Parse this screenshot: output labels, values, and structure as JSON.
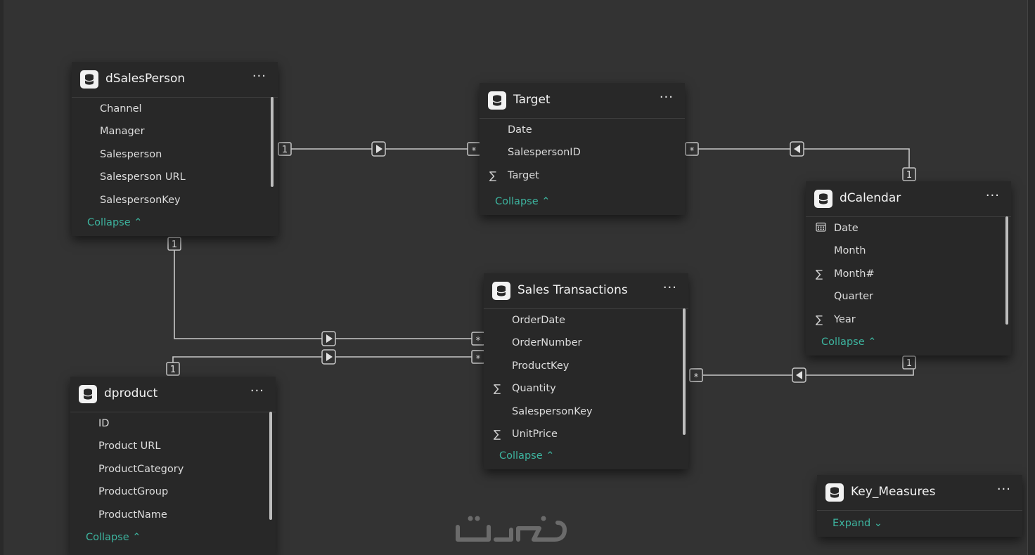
{
  "tables": {
    "dsalesperson": {
      "name": "dSalesPerson",
      "fields": [
        "Channel",
        "Manager",
        "Salesperson",
        "Salesperson URL",
        "SalespersonKey"
      ],
      "toggle": "Collapse"
    },
    "target": {
      "name": "Target",
      "fields": [
        "Date",
        "SalespersonID",
        "Target"
      ],
      "toggle": "Collapse"
    },
    "dcalendar": {
      "name": "dCalendar",
      "fields": [
        "Date",
        "Month",
        "Month#",
        "Quarter",
        "Year"
      ],
      "toggle": "Collapse"
    },
    "sales_transactions": {
      "name": "Sales Transactions",
      "fields": [
        "OrderDate",
        "OrderNumber",
        "ProductKey",
        "Quantity",
        "SalespersonKey",
        "UnitPrice"
      ],
      "toggle": "Collapse"
    },
    "dproduct": {
      "name": "dproduct",
      "fields": [
        "ID",
        "Product URL",
        "ProductCategory",
        "ProductGroup",
        "ProductName"
      ],
      "toggle": "Collapse"
    },
    "key_measures": {
      "name": "Key_Measures",
      "toggle": "Expand"
    }
  },
  "more_label": "···",
  "cardinality": {
    "one": "1",
    "many": "*"
  },
  "icons": {
    "table": "database-icon",
    "sum": "sigma-icon",
    "calendar": "calendar-icon",
    "filter_right": "filter-direction-right-icon",
    "filter_left": "filter-direction-left-icon"
  },
  "colors": {
    "canvas": "#333333",
    "card": "#282828",
    "accent": "#3db39e",
    "line": "#c8c8c8"
  },
  "watermark": "خدسات"
}
